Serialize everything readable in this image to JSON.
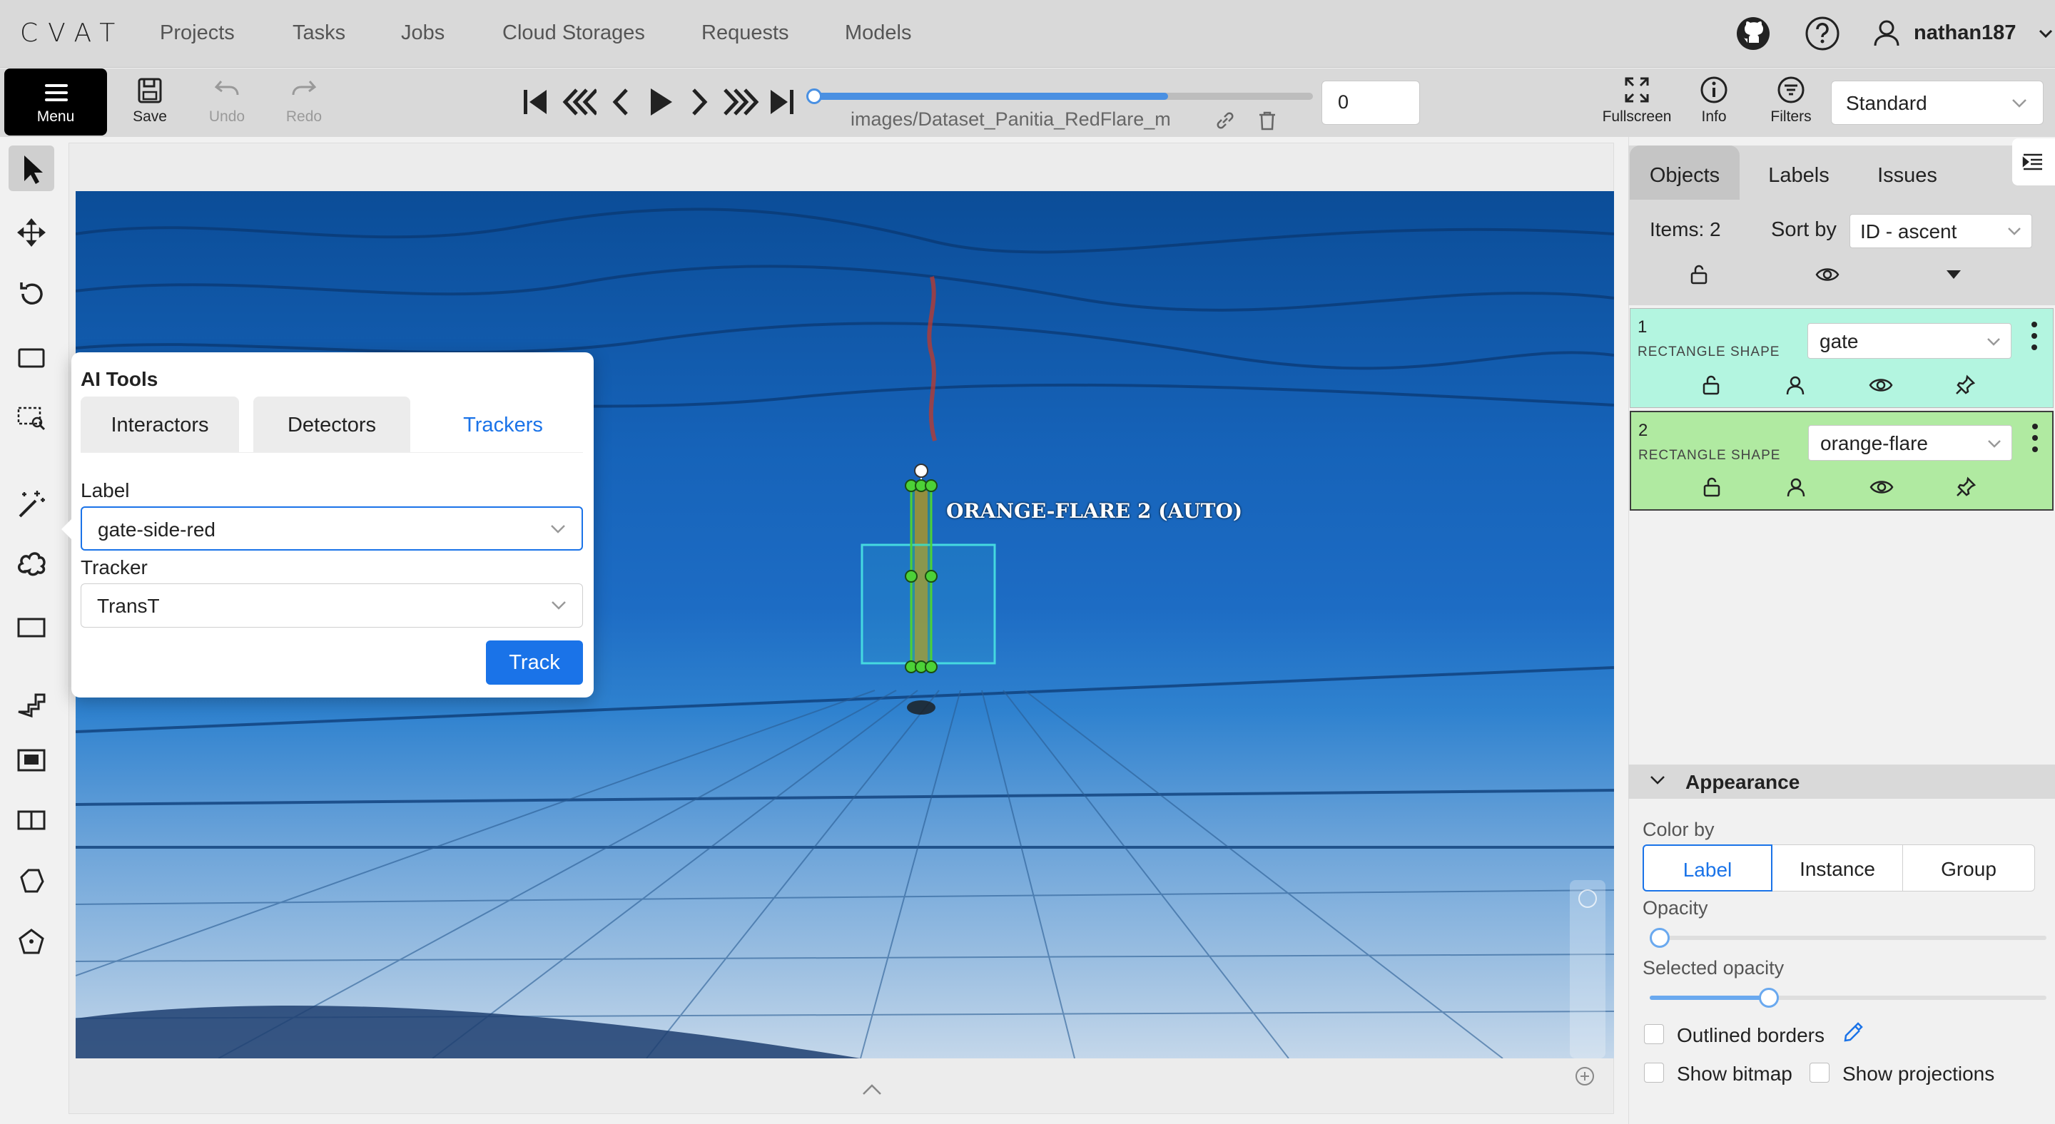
{
  "nav": {
    "logo": "CVAT",
    "links": [
      "Projects",
      "Tasks",
      "Jobs",
      "Cloud Storages",
      "Requests",
      "Models"
    ],
    "user": "nathan187",
    "icons": [
      "github-icon",
      "help-icon",
      "user-icon"
    ]
  },
  "toolbar": {
    "menu_label": "Menu",
    "save_label": "Save",
    "undo_label": "Undo",
    "redo_label": "Redo",
    "filename": "images/Dataset_Panitia_RedFlare_m",
    "frame": "0",
    "frame_progress": 0.71,
    "fullscreen_label": "Fullscreen",
    "info_label": "Info",
    "filters_label": "Filters",
    "workspace": "Standard"
  },
  "canvas": {
    "object_label": "ORANGE-FLARE 2 (AUTO)"
  },
  "ai_tools": {
    "title": "AI Tools",
    "tabs": [
      "Interactors",
      "Detectors",
      "Trackers"
    ],
    "active_tab": "Trackers",
    "label_title": "Label",
    "label_value": "gate-side-red",
    "tracker_title": "Tracker",
    "tracker_value": "TransT",
    "track_button": "Track"
  },
  "sidebar": {
    "tabs": [
      "Objects",
      "Labels",
      "Issues"
    ],
    "active_tab": "Objects",
    "items_count": "Items: 2",
    "sort_by_label": "Sort by",
    "sort_value": "ID - ascent",
    "objects": [
      {
        "id": "1",
        "type": "RECTANGLE SHAPE",
        "label": "gate",
        "color": "#b3f5e0"
      },
      {
        "id": "2",
        "type": "RECTANGLE SHAPE",
        "label": "orange-flare",
        "color": "#b0eaa1"
      }
    ],
    "appearance": {
      "title": "Appearance",
      "color_by_label": "Color by",
      "color_by_options": [
        "Label",
        "Instance",
        "Group"
      ],
      "color_by_selected": "Label",
      "opacity_label": "Opacity",
      "opacity_value": 0.0,
      "selected_opacity_label": "Selected opacity",
      "selected_opacity_value": 0.3,
      "outlined_borders_label": "Outlined borders",
      "show_bitmap_label": "Show bitmap",
      "show_projections_label": "Show projections"
    }
  },
  "colors": {
    "accent": "#1a73e8",
    "object_green": "#4cd137",
    "object_cyan": "#45d9e0"
  }
}
